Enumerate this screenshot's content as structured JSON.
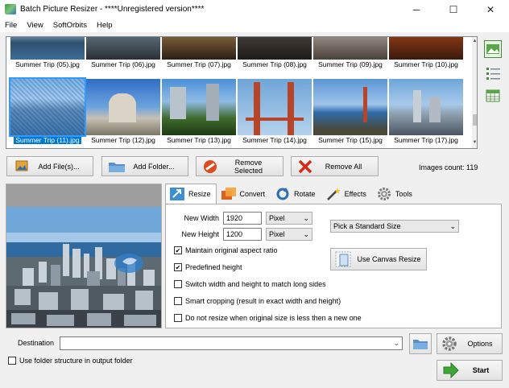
{
  "window": {
    "title": "Batch Picture Resizer - ****Unregistered version****",
    "minimize_glyph": "─",
    "maximize_glyph": "☐",
    "close_glyph": "✕"
  },
  "menu": [
    "File",
    "View",
    "SoftOrbits",
    "Help"
  ],
  "gallery": {
    "row1": [
      "Summer Trip (05).jpg",
      "Summer Trip (06).jpg",
      "Summer Trip (07).jpg",
      "Summer Trip (08).jpg",
      "Summer Trip (09).jpg",
      "Summer Trip (10).jpg"
    ],
    "row2": [
      "Summer Trip (11).jpg",
      "Summer Trip (12).jpg",
      "Summer Trip (13).jpg",
      "Summer Trip (14).jpg",
      "Summer Trip (15).jpg",
      "Summer Trip (17).jpg"
    ],
    "selected": "Summer Trip (11).jpg",
    "scroll_up": "▲",
    "scroll_down": "▼"
  },
  "actions": {
    "add_files": "Add File(s)...",
    "add_folder": "Add Folder...",
    "remove_selected": "Remove Selected",
    "remove_all": "Remove All",
    "images_count": "Images count: 119"
  },
  "tabs": [
    "Resize",
    "Convert",
    "Rotate",
    "Effects",
    "Tools"
  ],
  "resize": {
    "new_width_label": "New Width",
    "new_width": "1920",
    "new_height_label": "New Height",
    "new_height": "1200",
    "unit": "Pixel",
    "standard_size": "Pick a Standard Size",
    "dropdown_arrow": "⌄",
    "maintain_aspect": "Maintain original aspect ratio",
    "maintain_aspect_checked": "✔",
    "predefined_height": "Predefined height",
    "predefined_height_checked": "✔",
    "switch_wh": "Switch width and height to match long sides",
    "smart_crop": "Smart cropping (result in exact width and height)",
    "no_resize_small": "Do not resize when original size is less then a new one",
    "canvas_resize": "Use Canvas Resize"
  },
  "bottom": {
    "destination_label": "Destination",
    "destination_value": "",
    "use_folder_structure": "Use folder structure in output folder",
    "options": "Options",
    "start": "Start"
  },
  "colors": {
    "accent": "#0078d7",
    "title_bg": "#ffffff",
    "window_bg": "#f0f0f0",
    "selection": "#3399ff"
  }
}
